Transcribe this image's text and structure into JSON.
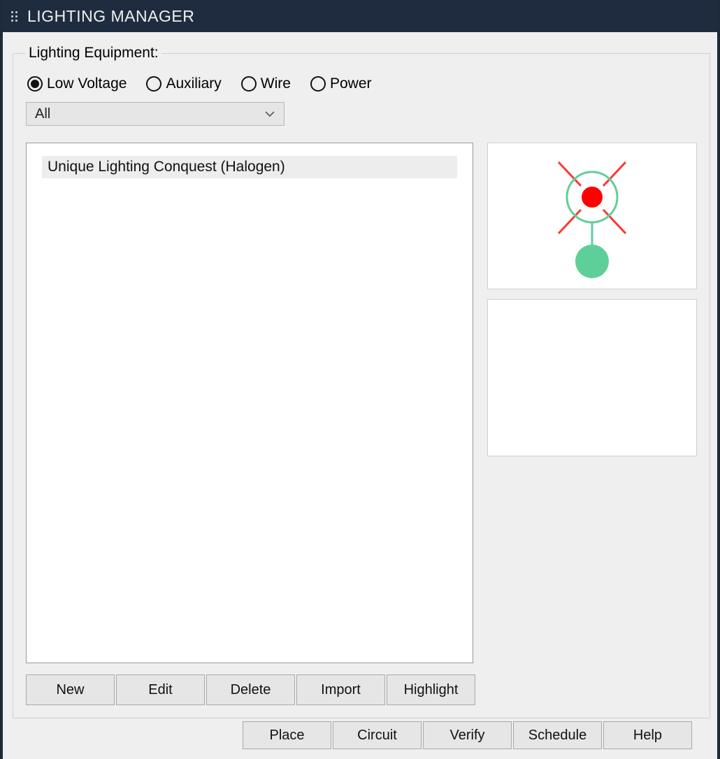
{
  "window": {
    "title": "LIGHTING MANAGER"
  },
  "equipment": {
    "legend": "Lighting Equipment:",
    "radios": [
      {
        "label": "Low Voltage",
        "selected": true
      },
      {
        "label": "Auxiliary",
        "selected": false
      },
      {
        "label": "Wire",
        "selected": false
      },
      {
        "label": "Power",
        "selected": false
      }
    ],
    "filter": {
      "selected": "All"
    },
    "list": [
      "Unique Lighting Conquest (Halogen)"
    ],
    "preview_icon": "light-fixture-symbol"
  },
  "actions": {
    "new_label": "New",
    "edit_label": "Edit",
    "delete_label": "Delete",
    "import_label": "Import",
    "highlight_label": "Highlight"
  },
  "bottom": {
    "place_label": "Place",
    "circuit_label": "Circuit",
    "verify_label": "Verify",
    "schedule_label": "Schedule",
    "help_label": "Help"
  }
}
